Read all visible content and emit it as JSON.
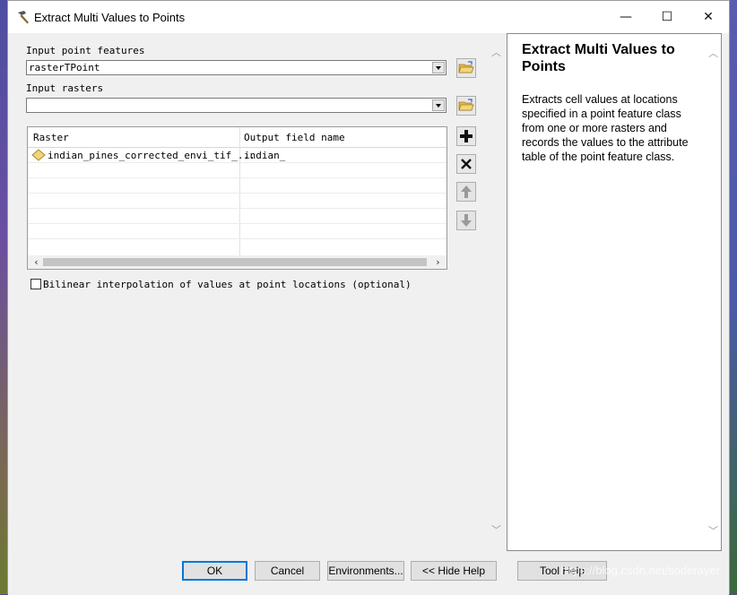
{
  "window": {
    "title": "Extract Multi Values to Points",
    "minimize": "—",
    "maximize": "☐",
    "close": "✕"
  },
  "form": {
    "input_point_label": "Input point features",
    "input_point_value": "rasterTPoint",
    "input_rasters_label": "Input rasters",
    "input_rasters_value": "",
    "grid": {
      "headers": [
        "Raster",
        "Output field name"
      ],
      "rows": [
        {
          "raster": "indian_pines_corrected_envi_tif_...",
          "field": "indian_"
        }
      ]
    },
    "bilinear_label": "Bilinear interpolation of values at point locations (optional)",
    "bilinear_checked": false
  },
  "side_buttons": {
    "add": "+",
    "remove": "✕",
    "up": "↑",
    "down": "↓"
  },
  "help": {
    "title": "Extract Multi Values to Points",
    "body": "Extracts cell values at locations specified in a point feature class from one or more rasters and records the values to the attribute table of the point feature class."
  },
  "buttons": {
    "ok": "OK",
    "cancel": "Cancel",
    "environments": "Environments...",
    "hide_help": "<< Hide Help",
    "tool_help": "Tool Help"
  },
  "watermark": "https://blog.csdn.net/soderayer"
}
